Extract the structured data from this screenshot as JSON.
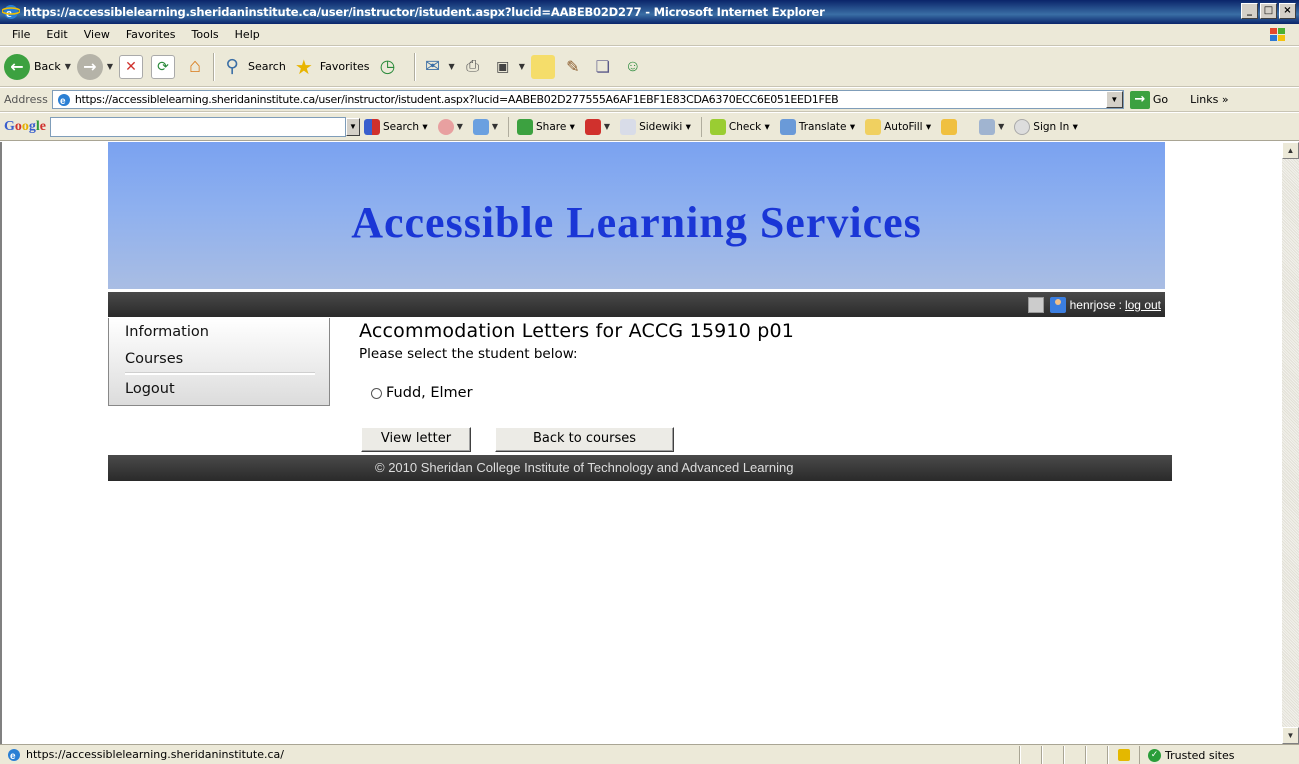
{
  "window": {
    "title": "https://accessiblelearning.sheridaninstitute.ca/user/instructor/istudent.aspx?lucid=AABEB02D277 - Microsoft Internet Explorer",
    "minimize": "_",
    "maximize": "□",
    "close": "×"
  },
  "menubar": {
    "items": [
      "File",
      "Edit",
      "View",
      "Favorites",
      "Tools",
      "Help"
    ]
  },
  "toolbar": {
    "back_label": "Back",
    "search_label": "Search",
    "favorites_label": "Favorites"
  },
  "address": {
    "label": "Address",
    "url": "https://accessiblelearning.sheridaninstitute.ca/user/instructor/istudent.aspx?lucid=AABEB02D277555A6AF1EBF1E83CDA6370ECC6E051EED1FEB",
    "go_label": "Go",
    "links_label": "Links »"
  },
  "google_bar": {
    "logo": [
      "G",
      "o",
      "o",
      "g",
      "l",
      "e"
    ],
    "search_value": "",
    "items": {
      "search": "Search ▾",
      "share": "Share ▾",
      "sidewiki": "Sidewiki ▾",
      "check": "Check ▾",
      "translate": "Translate ▾",
      "autofill": "AutoFill ▾",
      "signin": "Sign In ▾"
    }
  },
  "page": {
    "banner_title": "Accessible Learning Services",
    "user": {
      "name": "henrjose",
      "separator": ":",
      "logout": "log out"
    },
    "nav": [
      "Information",
      "Courses",
      "Logout"
    ],
    "heading": "Accommodation Letters for ACCG 15910 p01",
    "subtitle": "Please select the student below:",
    "students": [
      {
        "name": "Fudd, Elmer",
        "selected": false
      }
    ],
    "buttons": {
      "view_letter": "View letter",
      "back_to_courses": "Back to courses"
    },
    "footer": "© 2010 Sheridan College Institute of Technology and Advanced Learning"
  },
  "statusbar": {
    "text": "https://accessiblelearning.sheridaninstitute.ca/",
    "zone": "Trusted sites"
  },
  "colors": {
    "banner_title": "#1a36d6",
    "banner_top": "#7aa2f0",
    "dark_bar": "#3a3a3a"
  }
}
